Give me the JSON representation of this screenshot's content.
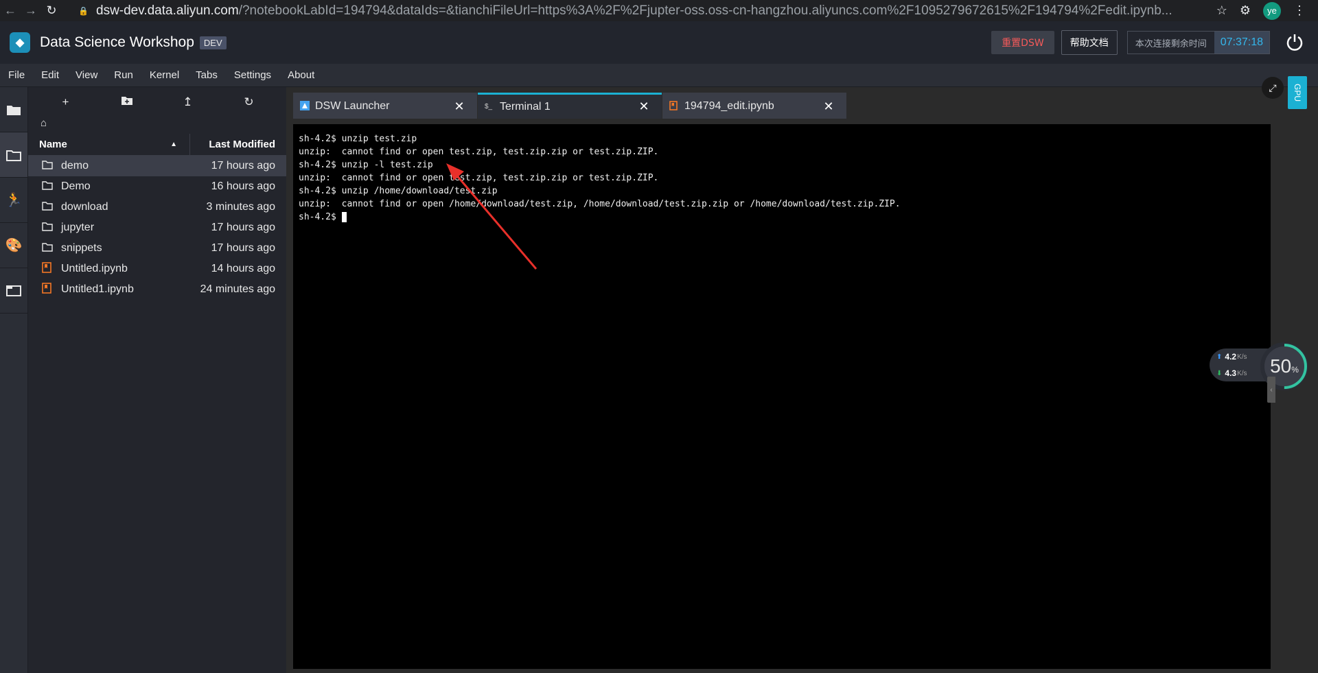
{
  "browser": {
    "url_host": "dsw-dev.data.aliyun.com",
    "url_rest": "/?notebookLabId=194794&dataIds=&tianchiFileUrl=https%3A%2F%2Fjupter-oss.oss-cn-hangzhou.aliyuncs.com%2F1095279672615%2F194794%2Fedit.ipynb...",
    "profile_initials": "ye"
  },
  "header": {
    "title": "Data Science Workshop",
    "badge": "DEV",
    "reset_label": "重置DSW",
    "help_label": "帮助文档",
    "time_label": "本次连接剩余时间",
    "time_value": "07:37:18"
  },
  "menu": [
    "File",
    "Edit",
    "View",
    "Run",
    "Kernel",
    "Tabs",
    "Settings",
    "About"
  ],
  "filebrowser": {
    "col_name": "Name",
    "col_modified": "Last Modified",
    "rows": [
      {
        "name": "demo",
        "type": "folder",
        "modified": "17 hours ago"
      },
      {
        "name": "Demo",
        "type": "folder",
        "modified": "16 hours ago"
      },
      {
        "name": "download",
        "type": "folder",
        "modified": "3 minutes ago"
      },
      {
        "name": "jupyter",
        "type": "folder",
        "modified": "17 hours ago"
      },
      {
        "name": "snippets",
        "type": "folder",
        "modified": "17 hours ago"
      },
      {
        "name": "Untitled.ipynb",
        "type": "notebook",
        "modified": "14 hours ago"
      },
      {
        "name": "Untitled1.ipynb",
        "type": "notebook",
        "modified": "24 minutes ago"
      }
    ]
  },
  "tabs": [
    {
      "label": "DSW Launcher",
      "icon": "launcher-icon"
    },
    {
      "label": "Terminal 1",
      "icon": "terminal-icon"
    },
    {
      "label": "194794_edit.ipynb",
      "icon": "notebook-icon"
    }
  ],
  "terminal": {
    "lines": [
      "sh-4.2$ unzip test.zip",
      "unzip:  cannot find or open test.zip, test.zip.zip or test.zip.ZIP.",
      "sh-4.2$ unzip -l test.zip",
      "unzip:  cannot find or open test.zip, test.zip.zip or test.zip.ZIP.",
      "sh-4.2$ unzip /home/download/test.zip",
      "unzip:  cannot find or open /home/download/test.zip, /home/download/test.zip.zip or /home/download/test.zip.ZIP.",
      "sh-4.2$ "
    ]
  },
  "side": {
    "gpu_label": "GPU",
    "net_up": "4.2",
    "net_down": "4.3",
    "net_unit": "K/s",
    "gauge_value": "50",
    "gauge_unit": "%",
    "gauge_fraction": 0.5
  },
  "colors": {
    "accent": "#1bb1d3",
    "reset_text": "#f55a5a",
    "annotation_arrow": "#e8302a",
    "notebook_orange": "#f37726"
  }
}
